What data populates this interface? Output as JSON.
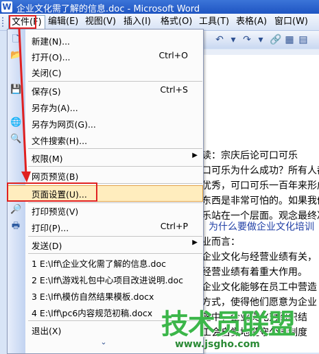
{
  "window": {
    "app_icon": "W",
    "title": "企业文化需了解的信息.doc - Microsoft Word"
  },
  "menubar": [
    {
      "label": "文件(F)",
      "name": "file"
    },
    {
      "label": "编辑(E)",
      "name": "edit"
    },
    {
      "label": "视图(V)",
      "name": "view"
    },
    {
      "label": "插入(I)",
      "name": "insert"
    },
    {
      "label": "格式(O)",
      "name": "format"
    },
    {
      "label": "工具(T)",
      "name": "tools"
    },
    {
      "label": "表格(A)",
      "name": "table"
    },
    {
      "label": "窗口(W)",
      "name": "window"
    }
  ],
  "file_menu": {
    "new": "新建(N)...",
    "open": {
      "label": "打开(O)...",
      "shortcut": "Ctrl+O"
    },
    "close": "关闭(C)",
    "save": {
      "label": "保存(S)",
      "shortcut": "Ctrl+S"
    },
    "save_as": "另存为(A)...",
    "save_as_web": "另存为网页(G)...",
    "file_search": "文件搜索(H)...",
    "permission": "权限(M)",
    "web_preview": "网页预览(B)",
    "page_setup": "页面设置(U)...",
    "print_preview": "打印预览(V)",
    "print": {
      "label": "打印(P)...",
      "shortcut": "Ctrl+P"
    },
    "send": "发送(D)",
    "recent": [
      "1 E:\\lff\\企业文化需了解的信息.doc",
      "2 E:\\lff\\游戏礼包中心项目改进说明.doc",
      "3 E:\\lff\\模仿自然结果模板.docx",
      "4 E:\\lff\\pc6内容规范初稿.docx"
    ],
    "exit": "退出(X)",
    "expand_glyph": "⌄"
  },
  "document": {
    "lines": [
      "读：宗庆后论可口可乐",
      "口可乐为什么成功？所有人都",
      "优秀，可口可乐一百年来形成",
      "东西是非常可怕的。如果我们",
      "乐站在一个层面。观念最终决",
      "为什么要做企业文化培训",
      "业而言：",
      "企业文化与经营业绩有关，",
      "经营业绩有着重大作用。",
      "企业文化能够在员工中营造",
      "方式，使得他们愿意为企业",
      "施中，企业文化对组织结",
      "工会自觉地遵守公司制度"
    ]
  },
  "watermark": {
    "main": "技术员联盟",
    "sub": "www.jsgho.com"
  },
  "colors": {
    "highlight_fill": "#ffedbe",
    "highlight_border": "#e2a348",
    "annotation_red": "#e02020"
  }
}
